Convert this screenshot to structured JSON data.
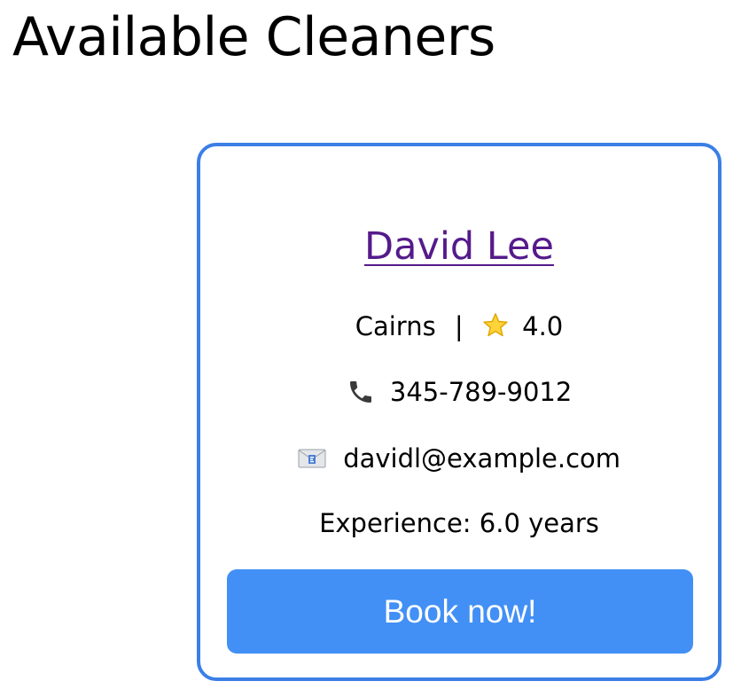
{
  "page": {
    "title": "Available Cleaners"
  },
  "cleaner": {
    "name": "David Lee",
    "location": "Cairns",
    "separator": "|",
    "rating": "4.0",
    "phone": "345-789-9012",
    "email": "davidl@example.com",
    "experience": "Experience: 6.0 years",
    "book_label": "Book now!"
  },
  "icons": {
    "rating": "star-icon",
    "phone": "phone-icon",
    "email": "envelope-icon"
  },
  "colors": {
    "card_border": "#3b7fe6",
    "button": "#4290f5",
    "link_visited": "#551a8b"
  }
}
